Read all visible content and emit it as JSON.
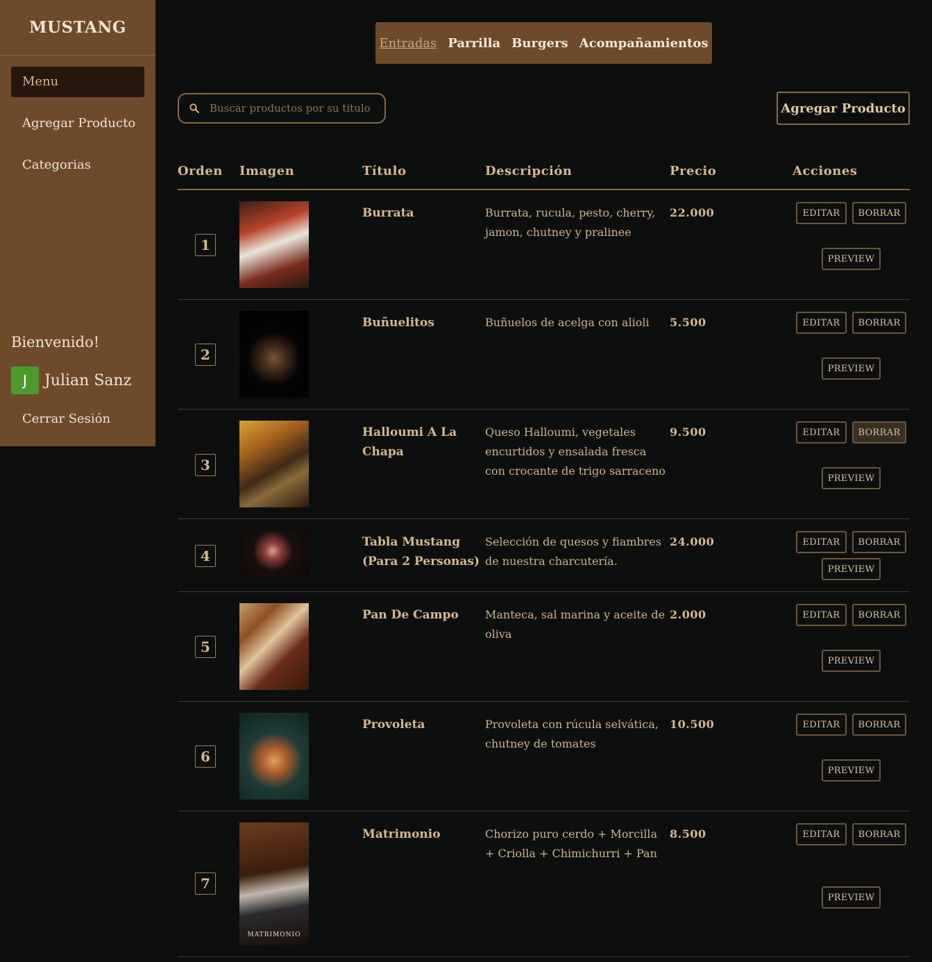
{
  "brand": "MUSTANG",
  "sidebar": {
    "items": [
      {
        "label": "Menu"
      },
      {
        "label": "Agregar Producto"
      },
      {
        "label": "Categorias"
      }
    ],
    "welcome": "Bienvenido!",
    "user_initial": "J",
    "user_name": "Julian Sanz",
    "logout": "Cerrar Sesión"
  },
  "tabs": [
    {
      "label": "Entradas",
      "active": true
    },
    {
      "label": "Parrilla"
    },
    {
      "label": "Burgers"
    },
    {
      "label": "Acompañamientos"
    }
  ],
  "search": {
    "placeholder": "Buscar productos por su titulo",
    "value": ""
  },
  "add_button": "Agregar Producto",
  "table": {
    "headers": {
      "order": "Orden",
      "image": "Imagen",
      "title": "Título",
      "description": "Descripción",
      "price": "Precio",
      "actions": "Acciones"
    },
    "actions": {
      "edit": "EDITAR",
      "delete": "BORRAR",
      "preview": "PREVIEW"
    },
    "rows": [
      {
        "order": "1",
        "title": "Burrata",
        "description": "Burrata, rucula, pesto, cherry, jamon, chutney y pralinee",
        "price": "22.000",
        "image": "burrata-photo"
      },
      {
        "order": "2",
        "title": "Buñuelitos",
        "description": "Buñuelos de acelga con alioli",
        "price": "5.500",
        "image": "bunuelitos-photo"
      },
      {
        "order": "3",
        "title": "Halloumi A La Chapa",
        "description": "Queso Halloumi, vegetales encurtidos y ensalada fresca con crocante de trigo sarraceno",
        "price": "9.500",
        "image": "halloumi-photo"
      },
      {
        "order": "4",
        "title": "Tabla Mustang (Para 2 Personas)",
        "description": "Selección de quesos y fiambres de nuestra charcutería.",
        "price": "24.000",
        "image": "tabla-photo"
      },
      {
        "order": "5",
        "title": "Pan De Campo",
        "description": "Manteca, sal marina y aceite de oliva",
        "price": "2.000",
        "image": "pan-photo"
      },
      {
        "order": "6",
        "title": "Provoleta",
        "description": "Provoleta con rúcula selvática, chutney de tomates",
        "price": "10.500",
        "image": "provoleta-photo"
      },
      {
        "order": "7",
        "title": "Matrimonio",
        "description": "Chorizo puro cerdo + Morcilla + Criolla + Chimichurri + Pan",
        "price": "8.500",
        "image": "matrimonio-photo",
        "image_caption": "MATRIMONIO"
      }
    ]
  }
}
